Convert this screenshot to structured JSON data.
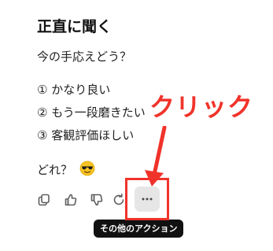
{
  "message": {
    "heading": "正直に聞く",
    "question": "今の手応えどう？",
    "options": [
      {
        "marker": "①",
        "text": "かなり良い"
      },
      {
        "marker": "②",
        "text": "もう一段磨きたい"
      },
      {
        "marker": "③",
        "text": "客観評価ほしい"
      }
    ],
    "closing": "どれ？"
  },
  "actions": {
    "copy_icon": "copy-icon",
    "like_icon": "thumbs-up-icon",
    "dislike_icon": "thumbs-down-icon",
    "retry_icon": "retry-icon",
    "more_icon": "more-horizontal-icon",
    "tooltip": "その他のアクション"
  },
  "annotation": {
    "label": "クリック",
    "color": "#f0332a"
  },
  "colors": {
    "icon": "#5f5f5f",
    "tooltip_bg": "#111111",
    "more_button_bg": "#e6e6e6"
  }
}
